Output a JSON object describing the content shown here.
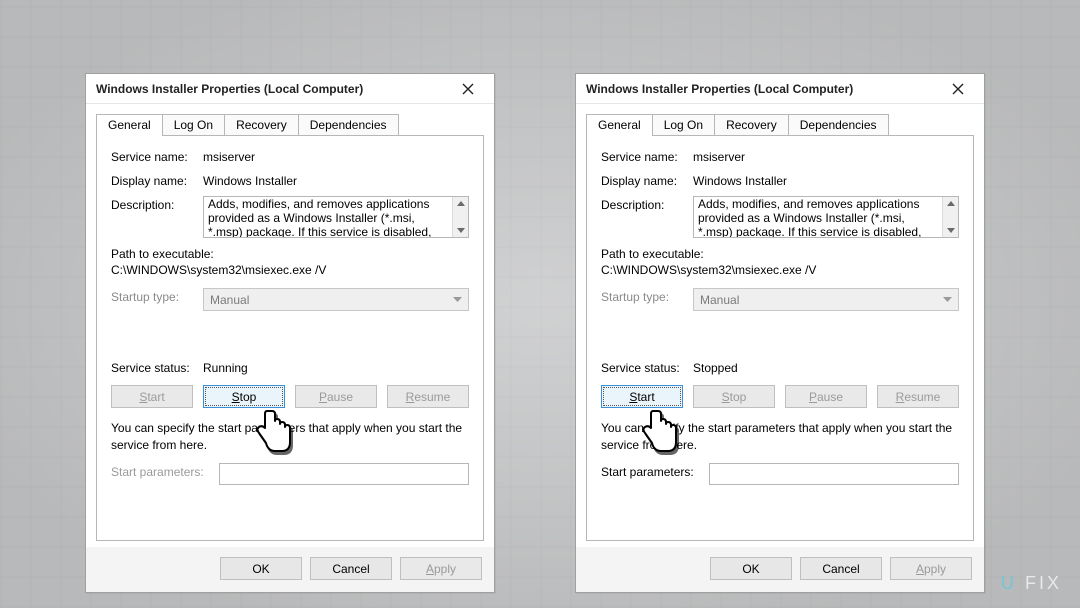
{
  "watermark": {
    "prefix": "U",
    "suffix": "FIX"
  },
  "dialogs": {
    "left": {
      "title": "Windows Installer Properties (Local Computer)",
      "tabs": [
        "General",
        "Log On",
        "Recovery",
        "Dependencies"
      ],
      "activeTab": "General",
      "serviceNameLabel": "Service name:",
      "serviceName": "msiserver",
      "displayNameLabel": "Display name:",
      "displayName": "Windows Installer",
      "descriptionLabel": "Description:",
      "description": "Adds, modifies, and removes applications provided as a Windows Installer (*.msi, *.msp) package. If this service is disabled, any services that explicitly",
      "pathLabel": "Path to executable:",
      "path": "C:\\WINDOWS\\system32\\msiexec.exe /V",
      "startupLabel": "Startup type:",
      "startupType": "Manual",
      "statusLabel": "Service status:",
      "status": "Running",
      "btns": {
        "start": "Start",
        "stop": "Stop",
        "pause": "Pause",
        "resume": "Resume"
      },
      "btnState": {
        "start": "disabled",
        "stop": "focus",
        "pause": "disabled",
        "resume": "disabled"
      },
      "note": "You can specify the start parameters that apply when you start the service from here.",
      "paramsLabel": "Start parameters:",
      "paramsValue": "",
      "paramsEnabled": false,
      "dlgBtns": {
        "ok": "OK",
        "cancel": "Cancel",
        "apply": "Apply"
      }
    },
    "right": {
      "title": "Windows Installer Properties (Local Computer)",
      "tabs": [
        "General",
        "Log On",
        "Recovery",
        "Dependencies"
      ],
      "activeTab": "General",
      "serviceNameLabel": "Service name:",
      "serviceName": "msiserver",
      "displayNameLabel": "Display name:",
      "displayName": "Windows Installer",
      "descriptionLabel": "Description:",
      "description": "Adds, modifies, and removes applications provided as a Windows Installer (*.msi, *.msp) package. If this service is disabled, any services that explicitly",
      "pathLabel": "Path to executable:",
      "path": "C:\\WINDOWS\\system32\\msiexec.exe /V",
      "startupLabel": "Startup type:",
      "startupType": "Manual",
      "statusLabel": "Service status:",
      "status": "Stopped",
      "btns": {
        "start": "Start",
        "stop": "Stop",
        "pause": "Pause",
        "resume": "Resume"
      },
      "btnState": {
        "start": "focus",
        "stop": "disabled",
        "pause": "disabled",
        "resume": "disabled"
      },
      "note": "You can specify the start parameters that apply when you start the service from here.",
      "paramsLabel": "Start parameters:",
      "paramsValue": "",
      "paramsEnabled": true,
      "dlgBtns": {
        "ok": "OK",
        "cancel": "Cancel",
        "apply": "Apply"
      }
    }
  }
}
